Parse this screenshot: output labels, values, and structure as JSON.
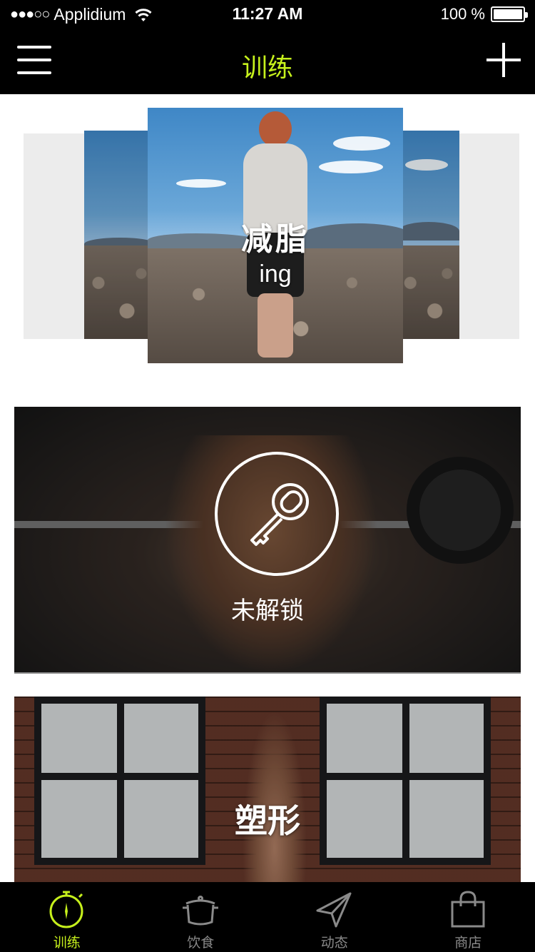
{
  "status_bar": {
    "signal": "●●●○○",
    "carrier": "Applidium",
    "time": "11:27 AM",
    "battery": "100 %"
  },
  "nav": {
    "title": "训练"
  },
  "carousel": {
    "active_title": "减脂",
    "active_subtitle": "ing"
  },
  "locked_banner": {
    "label": "未解锁"
  },
  "shape_banner": {
    "title": "塑形"
  },
  "tabbar": {
    "tabs": [
      {
        "label": "训练",
        "icon": "stopwatch-icon",
        "active": true
      },
      {
        "label": "饮食",
        "icon": "pot-icon",
        "active": false
      },
      {
        "label": "动态",
        "icon": "paper-plane-icon",
        "active": false
      },
      {
        "label": "商店",
        "icon": "shopping-bag-icon",
        "active": false
      }
    ]
  },
  "colors": {
    "accent": "#c6f01c",
    "bar_background": "#000000",
    "inactive_tab": "#8a8a8a"
  }
}
